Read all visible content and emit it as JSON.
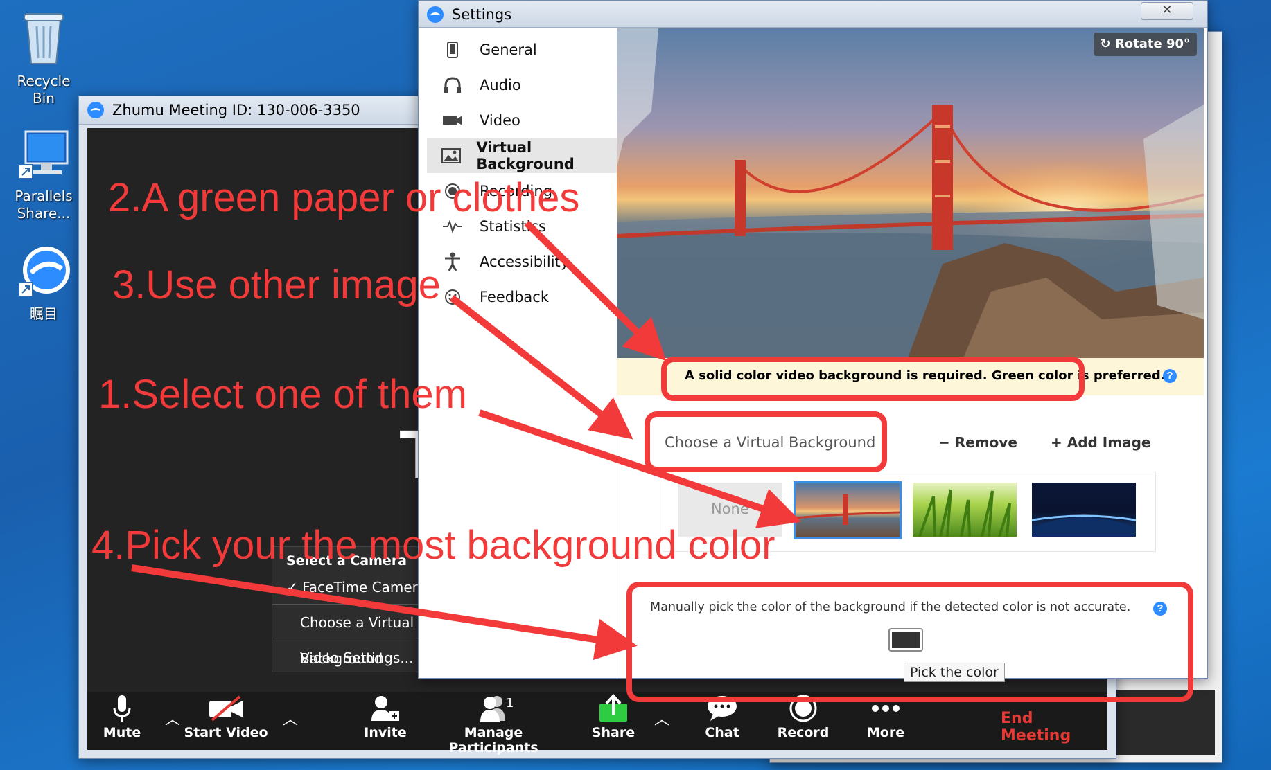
{
  "desktop": {
    "icons": [
      {
        "label": "Recycle Bin"
      },
      {
        "label": "Parallels Share..."
      },
      {
        "label": "瞩目"
      }
    ]
  },
  "meeting_window": {
    "title": "Zhumu Meeting ID: 130-006-3350",
    "video_letter": "T",
    "camera_menu": {
      "header": "Select a Camera",
      "items": [
        "✓ FaceTime Camera",
        "Choose a Virtual Background",
        "Video Settings..."
      ]
    },
    "toolbar": {
      "mute": "Mute",
      "start_video": "Start Video",
      "invite": "Invite",
      "manage_participants": "Manage Participants",
      "participant_count": "1",
      "share": "Share",
      "chat": "Chat",
      "record": "Record",
      "more": "More",
      "end_meeting": "End Meeting"
    }
  },
  "settings_window": {
    "title": "Settings",
    "close": "✕",
    "nav": [
      {
        "label": "General",
        "icon": "phone-icon"
      },
      {
        "label": "Audio",
        "icon": "headphones-icon"
      },
      {
        "label": "Video",
        "icon": "camera-icon"
      },
      {
        "label": "Virtual Background",
        "icon": "image-icon",
        "active": true
      },
      {
        "label": "Recording",
        "icon": "record-icon"
      },
      {
        "label": "Statistics",
        "icon": "pulse-icon"
      },
      {
        "label": "Accessibility",
        "icon": "person-icon"
      },
      {
        "label": "Feedback",
        "icon": "smile-icon"
      }
    ],
    "rotate": "Rotate 90°",
    "warning": "A solid color video background is required. Green color is preferred.",
    "choose_label": "Choose a Virtual Background",
    "remove": "Remove",
    "add_image": "Add Image",
    "none_thumb": "None",
    "manual_pick_text": "Manually pick the color of the background if the detected color is not accurate.",
    "pick_tooltip": "Pick the color",
    "picked_color": "#333333"
  },
  "annotations": {
    "note2": "2.A green paper or clothes",
    "note3": "3.Use other image",
    "note1": "1.Select one of them",
    "note4": "4.Pick your the most background color"
  },
  "colors": {
    "annotation_red": "#f23a3a",
    "end_meeting_red": "#e53935",
    "share_green": "#2ecc40",
    "selection_blue": "#3a8ee6"
  }
}
